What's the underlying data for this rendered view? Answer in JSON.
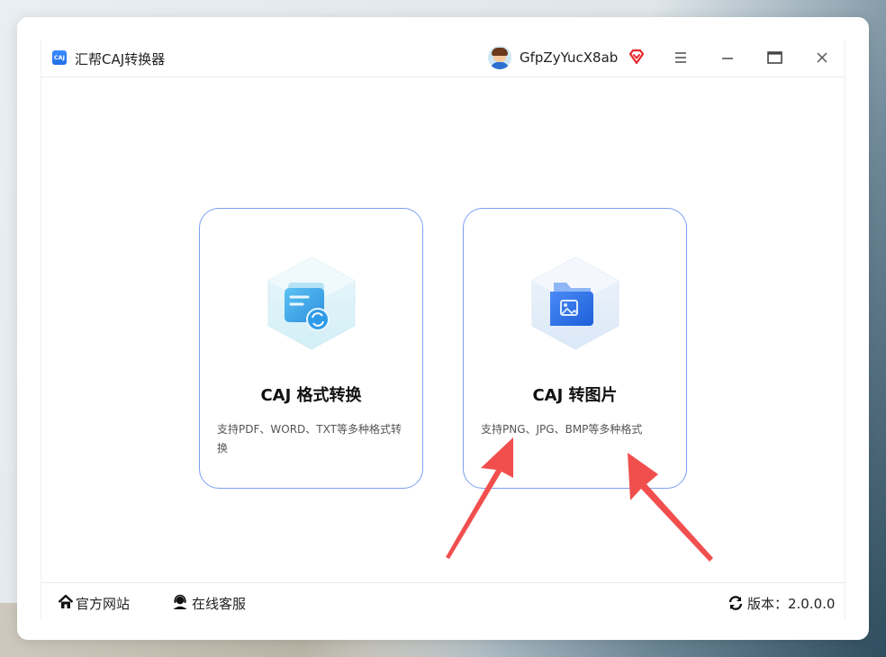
{
  "app": {
    "title": "汇帮CAJ转换器",
    "logo_text": "CAJ"
  },
  "user": {
    "name": "GfpZyYucX8ab",
    "badge_icon": "vip-diamond-icon"
  },
  "window_controls": {
    "menu": "menu-icon",
    "minimize": "minimize-icon",
    "maximize": "maximize-icon",
    "close": "close-icon"
  },
  "cards": [
    {
      "title": "CAJ 格式转换",
      "description": "支持PDF、WORD、TXT等多种格式转换",
      "icon": "document-convert-icon"
    },
    {
      "title": "CAJ 转图片",
      "description": "支持PNG、JPG、BMP等多种格式",
      "icon": "image-folder-icon"
    }
  ],
  "footer": {
    "website": "官方网站",
    "service": "在线客服",
    "version_label": "版本：2.0.0.0"
  },
  "colors": {
    "accent": "#3d7bf0",
    "card_border": "#7d9ff0",
    "annotation_arrow": "#f0504f"
  }
}
